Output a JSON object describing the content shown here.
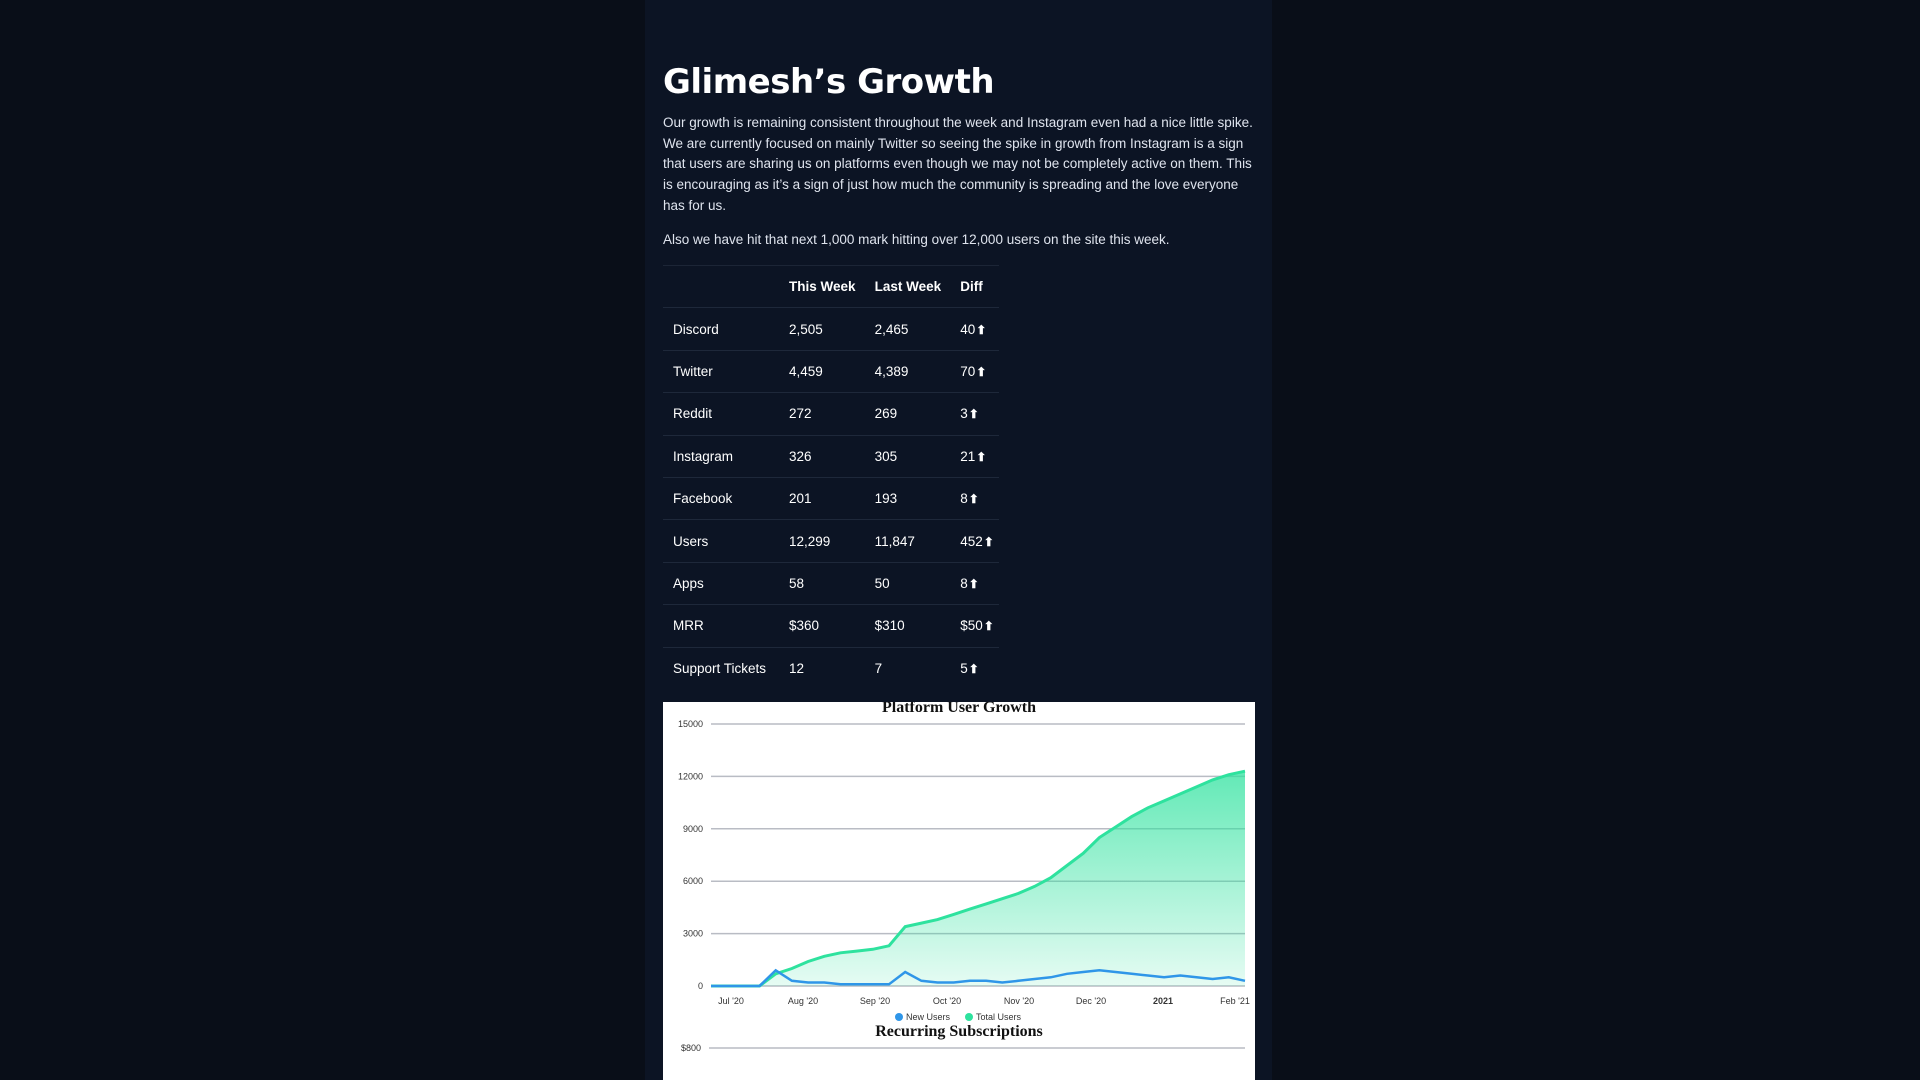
{
  "page": {
    "title": "Glimesh’s Growth",
    "paragraph1": "Our growth is remaining consistent throughout the week and Instagram even had a nice little spike. We are currently focused on mainly Twitter so seeing the spike in growth from Instagram is a sign that users are sharing us on platforms even though we may not be completely active on them. This is encouraging as it’s a sign of just how much the community is spreading and the love everyone has for us.",
    "paragraph2": "Also we have hit that next 1,000 mark hitting over 12,000 users on the site this week."
  },
  "table": {
    "headers": [
      "",
      "This Week",
      "Last Week",
      "Diff"
    ],
    "arrow": "⬆",
    "rows": [
      {
        "label": "Discord",
        "this_week": "2,505",
        "last_week": "2,465",
        "diff": "40"
      },
      {
        "label": "Twitter",
        "this_week": "4,459",
        "last_week": "4,389",
        "diff": "70"
      },
      {
        "label": "Reddit",
        "this_week": "272",
        "last_week": "269",
        "diff": "3"
      },
      {
        "label": "Instagram",
        "this_week": "326",
        "last_week": "305",
        "diff": "21"
      },
      {
        "label": "Facebook",
        "this_week": "201",
        "last_week": "193",
        "diff": "8"
      },
      {
        "label": "Users",
        "this_week": "12,299",
        "last_week": "11,847",
        "diff": "452"
      },
      {
        "label": "Apps",
        "this_week": "58",
        "last_week": "50",
        "diff": "8"
      },
      {
        "label": "MRR",
        "this_week": "$360",
        "last_week": "$310",
        "diff": "$50"
      },
      {
        "label": "Support Tickets",
        "this_week": "12",
        "last_week": "7",
        "diff": "5"
      }
    ]
  },
  "chart_data": [
    {
      "type": "area",
      "title": "Platform User Growth",
      "ylim": [
        0,
        15000
      ],
      "yticks": [
        "15000",
        "12000",
        "9000",
        "6000",
        "3000",
        "0"
      ],
      "xticks": [
        "Jul '20",
        "Aug '20",
        "Sep '20",
        "Oct '20",
        "Nov '20",
        "Dec '20",
        "2021",
        "Feb '21"
      ],
      "x": [
        0,
        1,
        2,
        3,
        4,
        5,
        6,
        7,
        8,
        9,
        10,
        11,
        12,
        13,
        14,
        15,
        16,
        17,
        18,
        19,
        20,
        21,
        22,
        23,
        24,
        25,
        26,
        27,
        28,
        29,
        30,
        31,
        32,
        33
      ],
      "series": [
        {
          "name": "Total Users",
          "color": "#2ee29e",
          "values": [
            0,
            0,
            0,
            0,
            700,
            1000,
            1400,
            1700,
            1900,
            2000,
            2100,
            2300,
            3400,
            3600,
            3800,
            4100,
            4400,
            4700,
            5000,
            5300,
            5700,
            6200,
            6900,
            7600,
            8500,
            9100,
            9700,
            10200,
            10600,
            11000,
            11400,
            11800,
            12100,
            12299
          ]
        },
        {
          "name": "New Users",
          "color": "#2f96e8",
          "values": [
            0,
            0,
            0,
            0,
            900,
            300,
            200,
            200,
            100,
            100,
            100,
            100,
            800,
            300,
            200,
            200,
            300,
            300,
            200,
            300,
            400,
            500,
            700,
            800,
            900,
            800,
            700,
            600,
            500,
            600,
            500,
            400,
            500,
            300
          ]
        }
      ]
    },
    {
      "type": "line",
      "title": "Recurring Subscriptions",
      "yticks": [
        "$800"
      ]
    }
  ]
}
